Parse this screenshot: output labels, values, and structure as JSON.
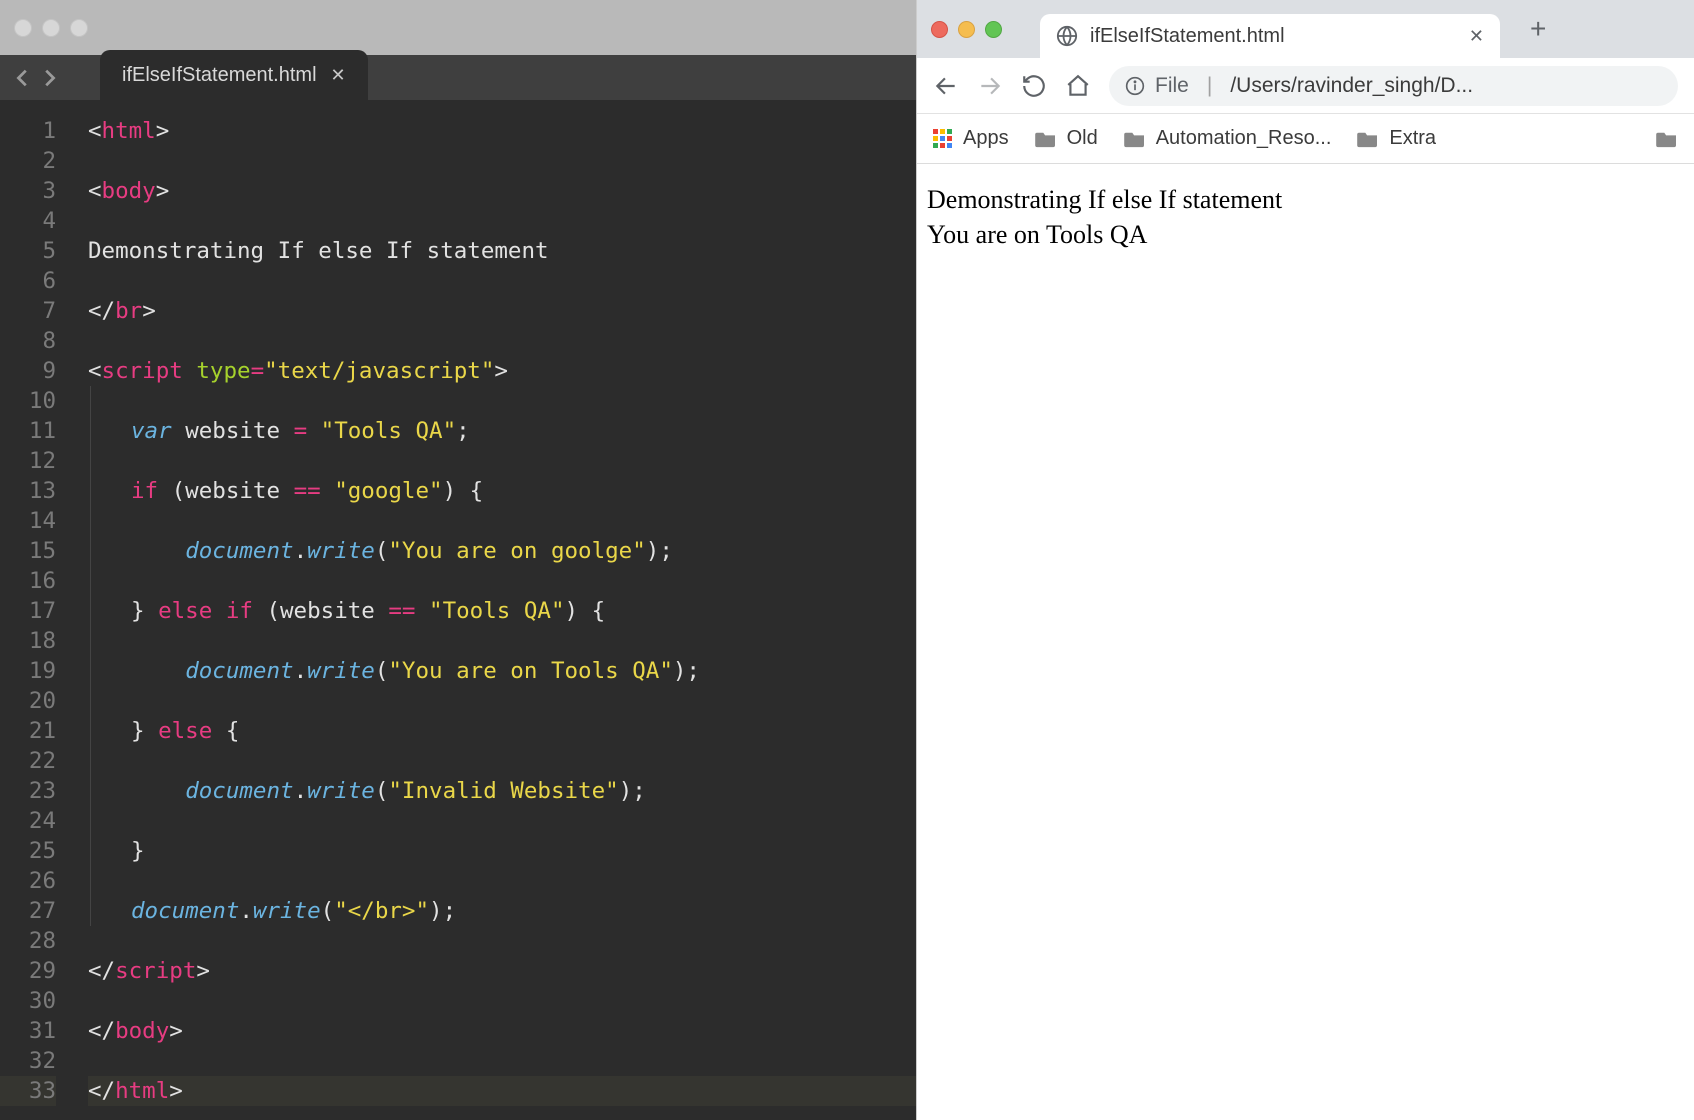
{
  "editor": {
    "tab_title": "ifElseIfStatement.html",
    "line_count": 33,
    "code": {
      "plain_line5": "Demonstrating If else If statement",
      "var_decl": {
        "kw": "var",
        "name": "website",
        "eq": "=",
        "val": "\"Tools QA\"",
        "semi": ";"
      },
      "if1": {
        "kw": "if",
        "open": "(website",
        "op": "==",
        "str": "\"google\"",
        "close": ") {"
      },
      "write_google": {
        "obj": "document",
        "dot": ".",
        "fn": "write",
        "args": "(\"You are on goolge\");"
      },
      "elseif": {
        "close_prev": "}",
        "kwelse": "else",
        "kwif": "if",
        "open": "(website",
        "op": "==",
        "str": "\"Tools QA\"",
        "close": ") {"
      },
      "write_tqa": {
        "obj": "document",
        "dot": ".",
        "fn": "write",
        "args": "(\"You are on Tools QA\");"
      },
      "else": {
        "close_prev": "}",
        "kw": "else",
        "open": "{"
      },
      "write_invalid": {
        "obj": "document",
        "dot": ".",
        "fn": "write",
        "args": "(\"Invalid Website\");"
      },
      "close_block": "}",
      "write_br": {
        "obj": "document",
        "dot": ".",
        "fn": "write",
        "args": "(\"</br>\");"
      },
      "tags": {
        "html_open": "html",
        "body_open": "body",
        "br_close": "br",
        "script_open": "script",
        "script_attr": "type",
        "script_val": "\"text/javascript\"",
        "script_close": "script",
        "body_close": "body",
        "html_close": "html"
      }
    }
  },
  "browser": {
    "tab_title": "ifElseIfStatement.html",
    "url_scheme": "File",
    "url_path": "/Users/ravinder_singh/D...",
    "bookmarks": {
      "apps": "Apps",
      "old": "Old",
      "automation": "Automation_Reso...",
      "extra": "Extra"
    },
    "page": {
      "line1": "Demonstrating If else If statement",
      "line2": "You are on Tools QA"
    }
  }
}
